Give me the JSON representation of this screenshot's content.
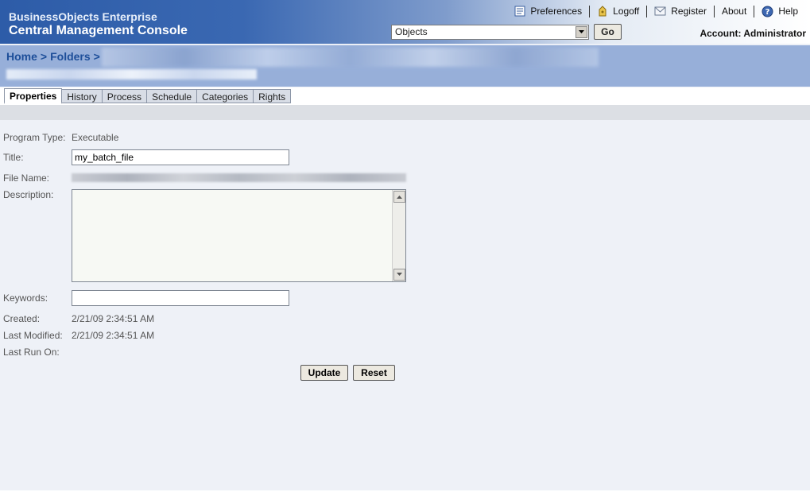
{
  "header": {
    "brand_line1": "BusinessObjects Enterprise",
    "brand_line2": "Central Management Console",
    "nav": [
      {
        "label": "Preferences",
        "icon": "preferences-icon"
      },
      {
        "label": "Logoff",
        "icon": "logoff-icon"
      },
      {
        "label": "Register",
        "icon": "register-icon"
      },
      {
        "label": "About",
        "icon": ""
      },
      {
        "label": "Help",
        "icon": "help-icon"
      }
    ],
    "object_select": "Objects",
    "go_label": "Go",
    "account": "Account: Administrator"
  },
  "breadcrumb": {
    "home": "Home",
    "sep": ">",
    "folders": "Folders"
  },
  "tabs": [
    "Properties",
    "History",
    "Process",
    "Schedule",
    "Categories",
    "Rights"
  ],
  "form": {
    "program_type_label": "Program Type:",
    "program_type_value": "Executable",
    "title_label": "Title:",
    "title_value": "my_batch_file",
    "file_name_label": "File Name:",
    "description_label": "Description:",
    "description_value": "",
    "keywords_label": "Keywords:",
    "keywords_value": "",
    "created_label": "Created:",
    "created_value": "2/21/09 2:34:51 AM",
    "last_modified_label": "Last Modified:",
    "last_modified_value": "2/21/09 2:34:51 AM",
    "last_run_label": "Last Run On:",
    "last_run_value": ""
  },
  "actions": {
    "update": "Update",
    "reset": "Reset"
  },
  "colors": {
    "header_blue": "#2d5ca8",
    "breadcrumb_band": "#97afd9",
    "link_blue": "#1d4e99",
    "page_bg": "#eef1f7"
  }
}
